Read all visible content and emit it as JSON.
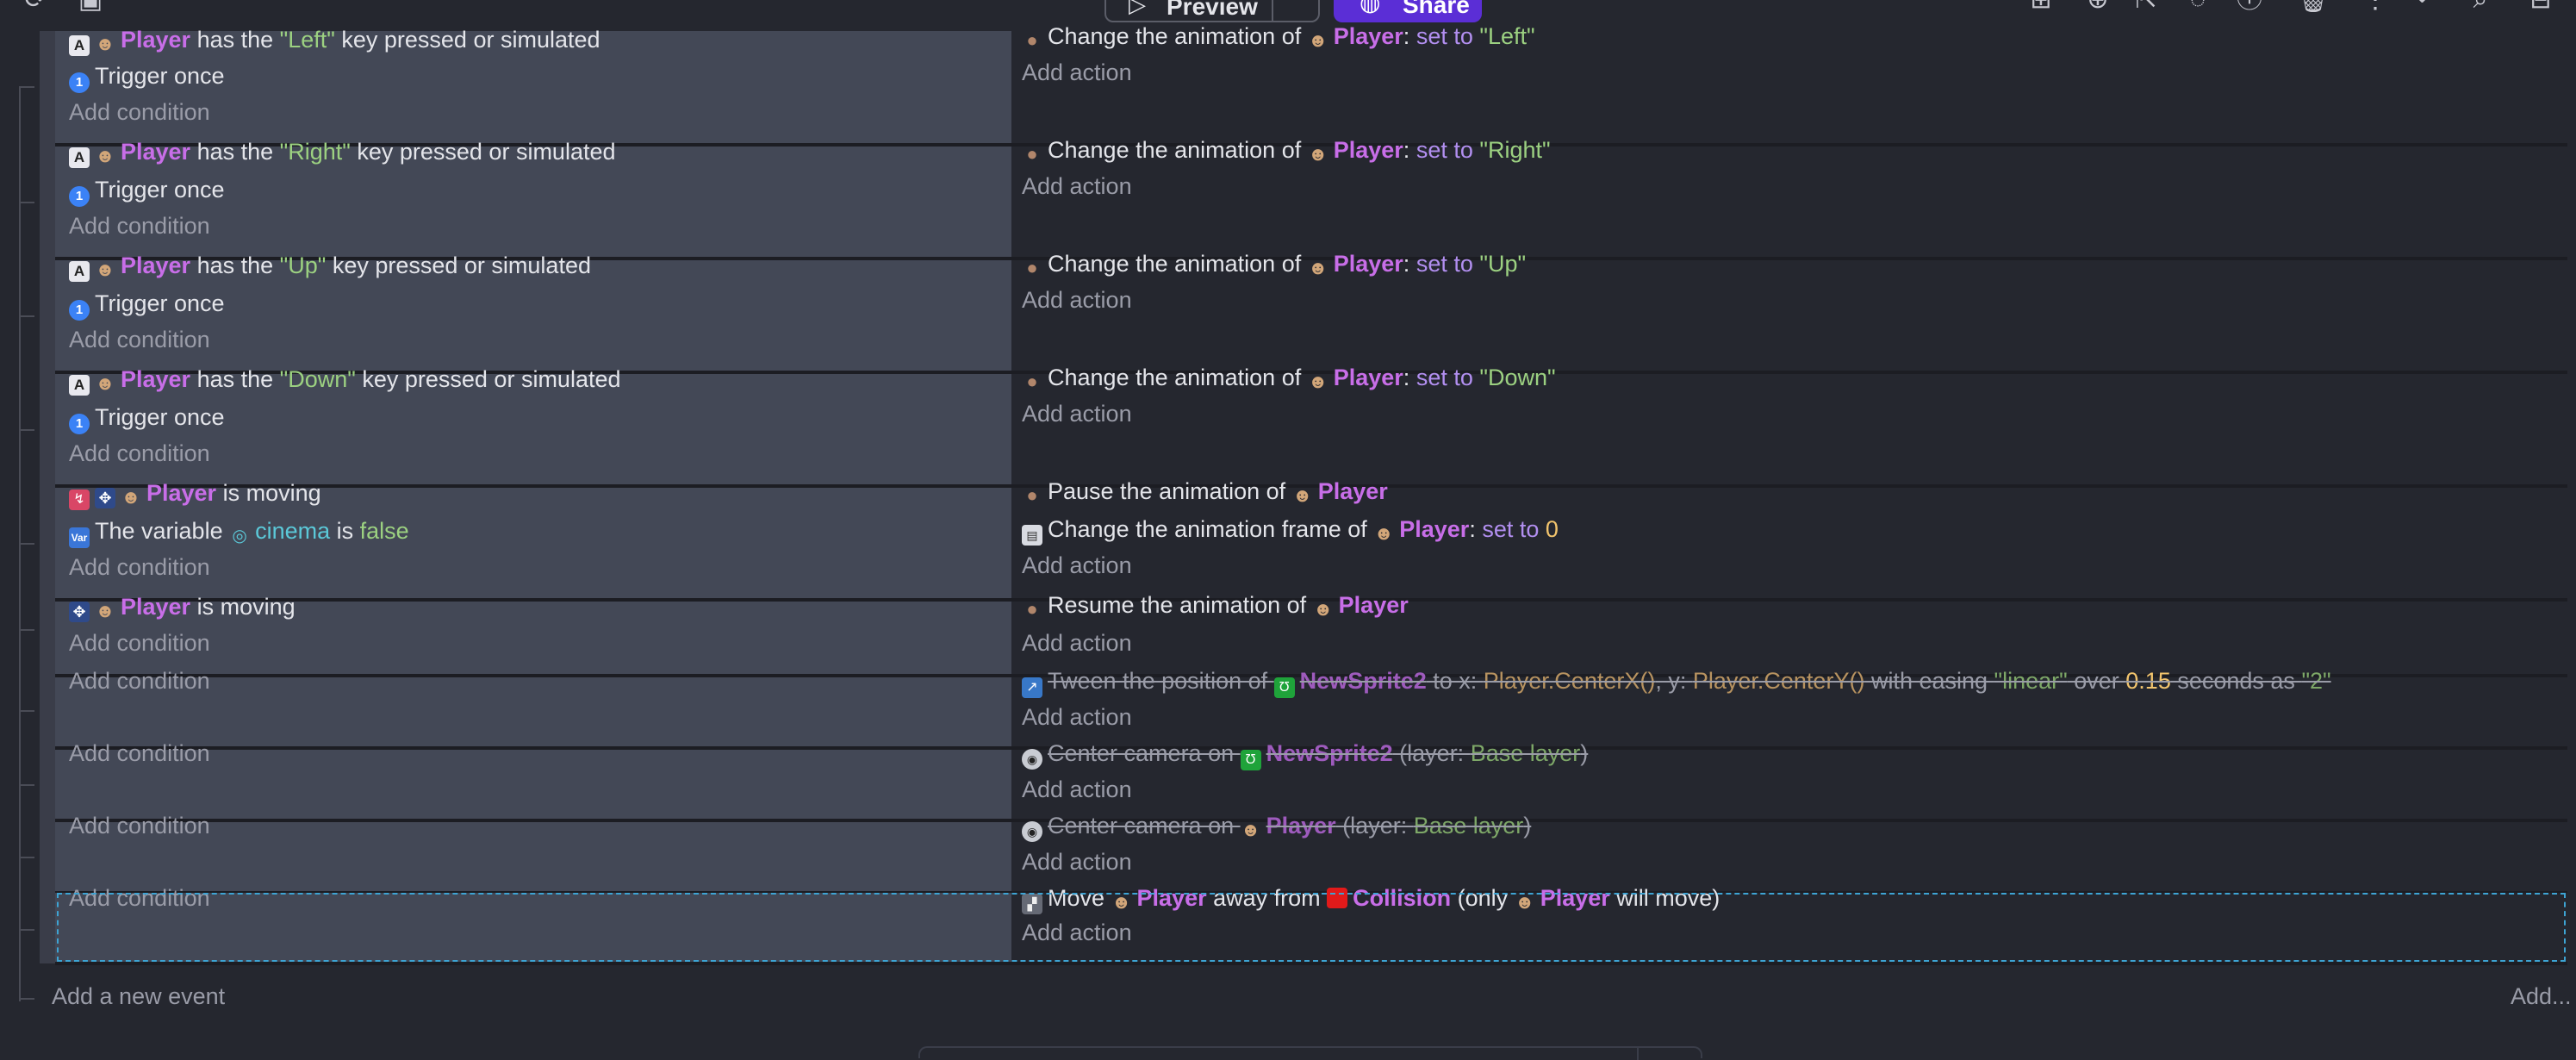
{
  "toolbar": {
    "left_icons": [
      "refresh-icon",
      "save-icon"
    ],
    "preview_label": "Preview",
    "share_label": "Share",
    "right_icons": [
      "add-event-icon",
      "add-subevent-icon",
      "add-else-icon",
      "add-comment-icon",
      "help-icon",
      "delete-icon",
      "more-icon",
      "search-icon",
      "settings-icon"
    ]
  },
  "events": [
    {
      "conditions": [
        {
          "icon": "keyboard-icon",
          "parts": [
            {
              "t": "obj",
              "v": "Player"
            },
            {
              "t": "txt",
              "v": " has the "
            },
            {
              "t": "str",
              "v": "\"Left\""
            },
            {
              "t": "txt",
              "v": " key pressed or simulated"
            }
          ]
        },
        {
          "icon": "trigger-once-icon",
          "parts": [
            {
              "t": "txt",
              "v": "Trigger once"
            }
          ]
        }
      ],
      "actions": [
        {
          "icon": "animation-icon",
          "parts": [
            {
              "t": "txt",
              "v": "Change the animation of "
            },
            {
              "t": "obj",
              "v": "Player"
            },
            {
              "t": "txt",
              "v": ": "
            },
            {
              "t": "kw",
              "v": "set to "
            },
            {
              "t": "str",
              "v": "\"Left\""
            }
          ]
        }
      ]
    },
    {
      "conditions": [
        {
          "icon": "keyboard-icon",
          "parts": [
            {
              "t": "obj",
              "v": "Player"
            },
            {
              "t": "txt",
              "v": " has the "
            },
            {
              "t": "str",
              "v": "\"Right\""
            },
            {
              "t": "txt",
              "v": " key pressed or simulated"
            }
          ]
        },
        {
          "icon": "trigger-once-icon",
          "parts": [
            {
              "t": "txt",
              "v": "Trigger once"
            }
          ]
        }
      ],
      "actions": [
        {
          "icon": "animation-icon",
          "parts": [
            {
              "t": "txt",
              "v": "Change the animation of "
            },
            {
              "t": "obj",
              "v": "Player"
            },
            {
              "t": "txt",
              "v": ": "
            },
            {
              "t": "kw",
              "v": "set to "
            },
            {
              "t": "str",
              "v": "\"Right\""
            }
          ]
        }
      ]
    },
    {
      "conditions": [
        {
          "icon": "keyboard-icon",
          "parts": [
            {
              "t": "obj",
              "v": "Player"
            },
            {
              "t": "txt",
              "v": " has the "
            },
            {
              "t": "str",
              "v": "\"Up\""
            },
            {
              "t": "txt",
              "v": " key pressed or simulated"
            }
          ]
        },
        {
          "icon": "trigger-once-icon",
          "parts": [
            {
              "t": "txt",
              "v": "Trigger once"
            }
          ]
        }
      ],
      "actions": [
        {
          "icon": "animation-icon",
          "parts": [
            {
              "t": "txt",
              "v": "Change the animation of "
            },
            {
              "t": "obj",
              "v": "Player"
            },
            {
              "t": "txt",
              "v": ": "
            },
            {
              "t": "kw",
              "v": "set to "
            },
            {
              "t": "str",
              "v": "\"Up\""
            }
          ]
        }
      ]
    },
    {
      "conditions": [
        {
          "icon": "keyboard-icon",
          "parts": [
            {
              "t": "obj",
              "v": "Player"
            },
            {
              "t": "txt",
              "v": " has the "
            },
            {
              "t": "str",
              "v": "\"Down\""
            },
            {
              "t": "txt",
              "v": " key pressed or simulated"
            }
          ]
        },
        {
          "icon": "trigger-once-icon",
          "parts": [
            {
              "t": "txt",
              "v": "Trigger once"
            }
          ]
        }
      ],
      "actions": [
        {
          "icon": "animation-icon",
          "parts": [
            {
              "t": "txt",
              "v": "Change the animation of "
            },
            {
              "t": "obj",
              "v": "Player"
            },
            {
              "t": "txt",
              "v": ": "
            },
            {
              "t": "kw",
              "v": "set to "
            },
            {
              "t": "str",
              "v": "\"Down\""
            }
          ]
        }
      ]
    },
    {
      "conditions": [
        {
          "icon": "invert-move-icon",
          "parts": [
            {
              "t": "obj",
              "v": "Player"
            },
            {
              "t": "txt",
              "v": " is moving"
            }
          ]
        },
        {
          "icon": "variable-icon",
          "parts": [
            {
              "t": "txt",
              "v": "The variable "
            },
            {
              "t": "var",
              "v": "cinema"
            },
            {
              "t": "txt",
              "v": " is "
            },
            {
              "t": "str",
              "v": "false"
            }
          ]
        }
      ],
      "actions": [
        {
          "icon": "animation-icon",
          "parts": [
            {
              "t": "txt",
              "v": "Pause the animation of "
            },
            {
              "t": "obj",
              "v": "Player"
            }
          ]
        },
        {
          "icon": "frame-icon",
          "parts": [
            {
              "t": "txt",
              "v": "Change the animation frame of "
            },
            {
              "t": "obj",
              "v": "Player"
            },
            {
              "t": "txt",
              "v": ": "
            },
            {
              "t": "kw",
              "v": "set to "
            },
            {
              "t": "num",
              "v": "0"
            }
          ]
        }
      ]
    },
    {
      "conditions": [
        {
          "icon": "movement-icon",
          "parts": [
            {
              "t": "obj",
              "v": "Player"
            },
            {
              "t": "txt",
              "v": " is moving"
            }
          ]
        }
      ],
      "actions": [
        {
          "icon": "animation-icon",
          "parts": [
            {
              "t": "txt",
              "v": "Resume the animation of "
            },
            {
              "t": "obj",
              "v": "Player"
            }
          ]
        }
      ]
    },
    {
      "conditions": [],
      "actions": [
        {
          "icon": "tween-icon",
          "disabled": true,
          "parts": [
            {
              "t": "txt",
              "v": "Tween the position of "
            },
            {
              "t": "sprite",
              "v": "NewSprite2"
            },
            {
              "t": "txt",
              "v": " to x: "
            },
            {
              "t": "expr",
              "v": "Player.CenterX()"
            },
            {
              "t": "txt",
              "v": ", y: "
            },
            {
              "t": "expr",
              "v": "Player.CenterY()"
            },
            {
              "t": "txt",
              "v": " with easing "
            },
            {
              "t": "str",
              "v": "\"linear\""
            },
            {
              "t": "txt",
              "v": " over "
            },
            {
              "t": "num",
              "v": "0.15"
            },
            {
              "t": "txt",
              "v": " seconds as "
            },
            {
              "t": "str",
              "v": "\"2\""
            }
          ]
        }
      ]
    },
    {
      "conditions": [],
      "actions": [
        {
          "icon": "camera-icon",
          "disabled": true,
          "parts": [
            {
              "t": "txt",
              "v": "Center camera on "
            },
            {
              "t": "sprite",
              "v": "NewSprite2"
            },
            {
              "t": "txt",
              "v": " (layer: "
            },
            {
              "t": "str",
              "v": "Base layer"
            },
            {
              "t": "txt",
              "v": ")"
            }
          ]
        }
      ]
    },
    {
      "conditions": [],
      "actions": [
        {
          "icon": "camera-icon",
          "disabled": true,
          "parts": [
            {
              "t": "txt",
              "v": "Center camera on "
            },
            {
              "t": "obj",
              "v": "Player"
            },
            {
              "t": "txt",
              "v": " (layer: "
            },
            {
              "t": "str",
              "v": "Base layer"
            },
            {
              "t": "txt",
              "v": ")"
            }
          ]
        }
      ]
    },
    {
      "selected": true,
      "conditions": [],
      "actions": [
        {
          "icon": "separate-icon",
          "parts": [
            {
              "t": "txt",
              "v": "Move "
            },
            {
              "t": "obj",
              "v": "Player"
            },
            {
              "t": "txt",
              "v": " away from "
            },
            {
              "t": "coll",
              "v": "Collision"
            },
            {
              "t": "txt",
              "v": " (only "
            },
            {
              "t": "obj",
              "v": "Player"
            },
            {
              "t": "txt",
              "v": " will move)"
            }
          ]
        }
      ]
    }
  ],
  "labels": {
    "add_condition": "Add condition",
    "add_action": "Add action",
    "add_new_event": "Add a new event",
    "add_more": "Add..."
  },
  "colors": {
    "object": "#c86ee8",
    "string": "#9cd181",
    "keyword": "#b28ff0",
    "number": "#f2c46d",
    "variable": "#5bc8d8",
    "selection": "#3da4d4",
    "share_button": "#5b2ed6"
  }
}
